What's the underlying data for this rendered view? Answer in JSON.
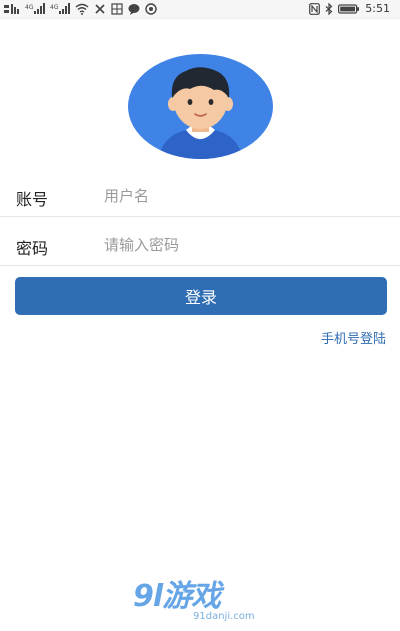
{
  "status_bar": {
    "time": "5:51",
    "network_left": "4G",
    "network_right": "4G",
    "icons_left": [
      "sim-signal-icon",
      "signal-bars-icon",
      "wifi-icon",
      "no-signal-icon",
      "notification-box-icon",
      "chat-icon",
      "settings-icon"
    ],
    "icons_right": [
      "nfc-icon",
      "bluetooth-icon",
      "battery-icon"
    ]
  },
  "avatar": {
    "bg_color": "#3f83e6",
    "skin_color": "#f5c9a4",
    "hair_color": "#222831",
    "shirt_color": "#2e64c8"
  },
  "form": {
    "account_label": "账号",
    "account_placeholder": "用户名",
    "password_label": "密码",
    "password_placeholder": "请输入密码"
  },
  "login_button": {
    "label": "登录",
    "color": "#2f6db4"
  },
  "phone_login_link": "手机号登陆",
  "watermark": {
    "main": "9l游戏",
    "sub": "91danji.com"
  }
}
